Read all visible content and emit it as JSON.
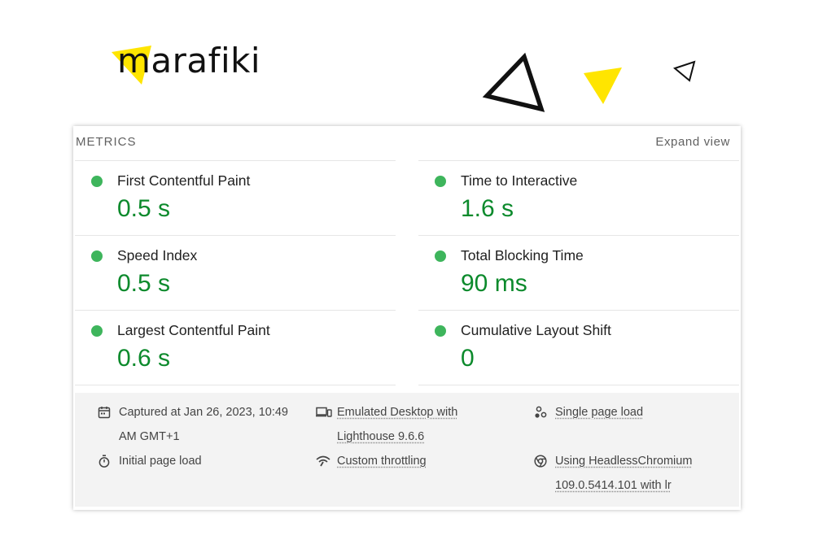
{
  "brand": {
    "name": "marafiki",
    "accent": "#ffe500",
    "ink": "#111111"
  },
  "report": {
    "section_title": "METRICS",
    "expand_label": "Expand view",
    "metrics": [
      {
        "label": "First Contentful Paint",
        "value": "0.5 s",
        "status": "pass"
      },
      {
        "label": "Time to Interactive",
        "value": "1.6 s",
        "status": "pass"
      },
      {
        "label": "Speed Index",
        "value": "0.5 s",
        "status": "pass"
      },
      {
        "label": "Total Blocking Time",
        "value": "90 ms",
        "status": "pass"
      },
      {
        "label": "Largest Contentful Paint",
        "value": "0.6 s",
        "status": "pass"
      },
      {
        "label": "Cumulative Layout Shift",
        "value": "0",
        "status": "pass"
      }
    ],
    "pass_color": "#0c8a2c",
    "pass_dot_color": "#3eb55c",
    "info": {
      "captured_line1": "Captured at Jan 26, 2023, 10:49",
      "captured_line2": "AM GMT+1",
      "emulated_line1": "Emulated Desktop with",
      "emulated_line2": "Lighthouse 9.6.6",
      "single_load": "Single page load",
      "initial_load": "Initial page load",
      "throttling": "Custom throttling",
      "browser_line1": "Using HeadlessChromium",
      "browser_line2": "109.0.5414.101 with lr"
    }
  }
}
